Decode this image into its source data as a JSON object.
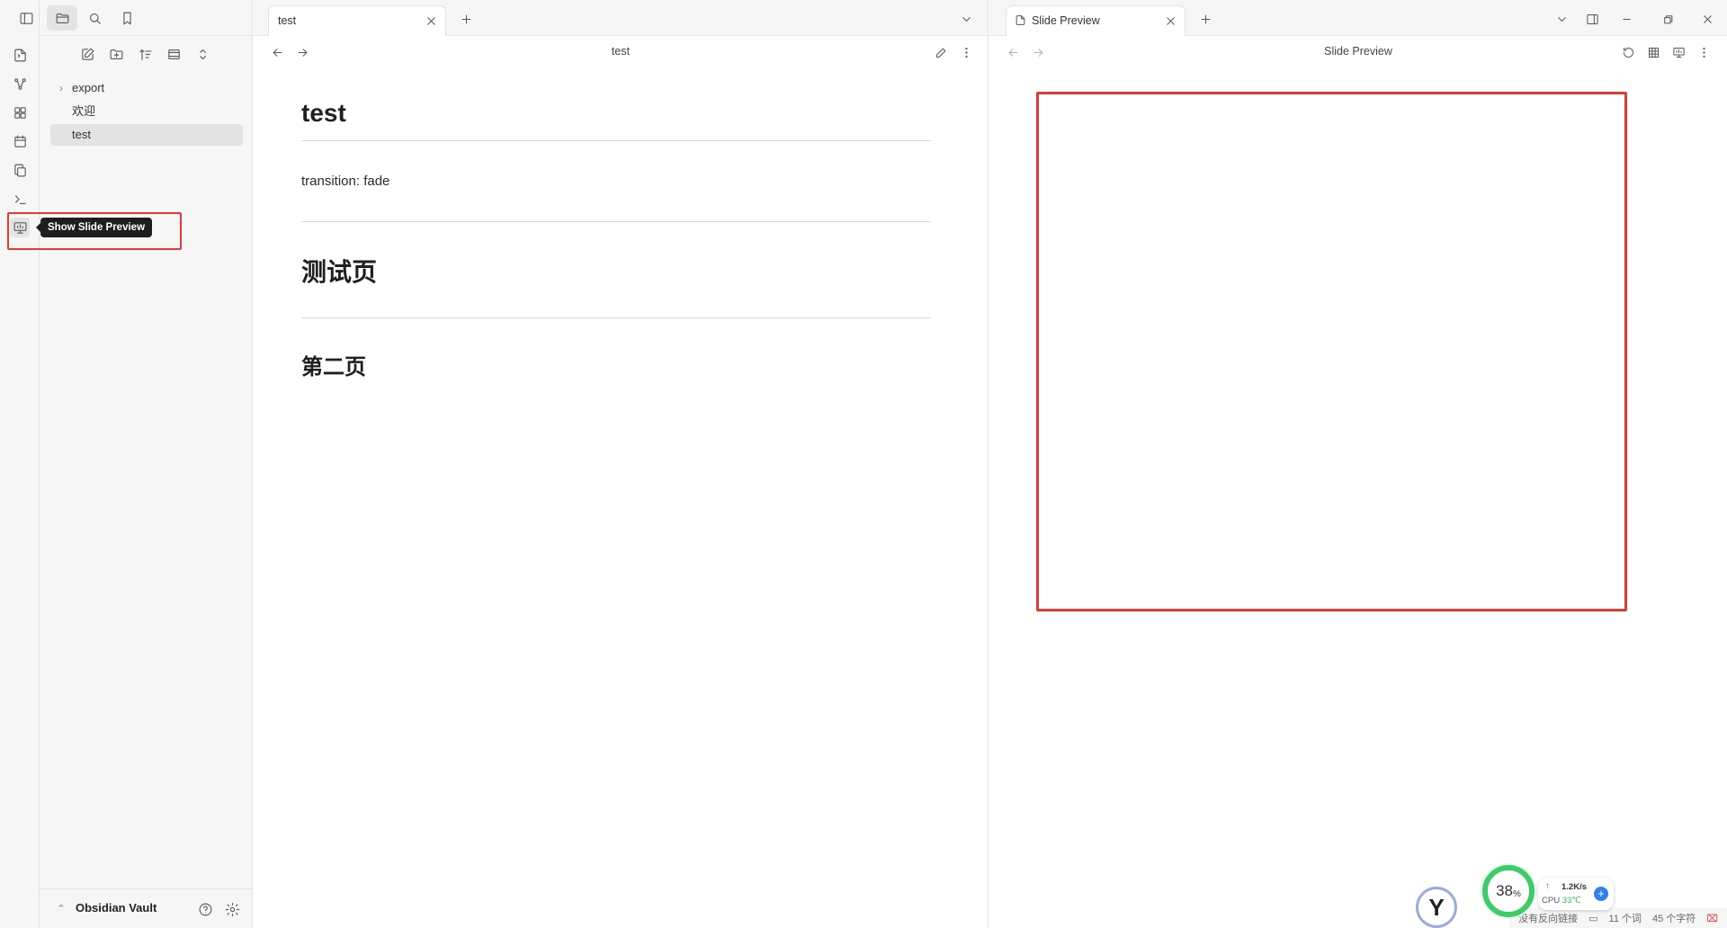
{
  "left_panel": {
    "tree": [
      {
        "label": "export",
        "type": "folder"
      },
      {
        "label": "欢迎",
        "type": "file"
      },
      {
        "label": "test",
        "type": "file",
        "active": true
      }
    ],
    "vault_name": "Obsidian Vault"
  },
  "tooltip": {
    "text": "Show Slide Preview"
  },
  "left_pane": {
    "tab_title": "test",
    "view_title": "test",
    "content": {
      "h1": "test",
      "para": "transition: fade",
      "h2": "测试页",
      "h3": "第二页"
    }
  },
  "right_pane": {
    "tab_title": "Slide Preview",
    "view_title": "Slide Preview"
  },
  "status_bar": {
    "backlinks": "没有反向链接",
    "words": "11 个词",
    "chars": "45 个字符"
  },
  "system_overlay": {
    "gauge_value": "38",
    "gauge_unit": "%",
    "net_speed": "1.2K/s",
    "cpu_label": "CPU",
    "cpu_temp": "33℃",
    "logo_letter": "Y"
  },
  "colors": {
    "highlight": "#e53935",
    "gauge": "#3fcb6a"
  }
}
